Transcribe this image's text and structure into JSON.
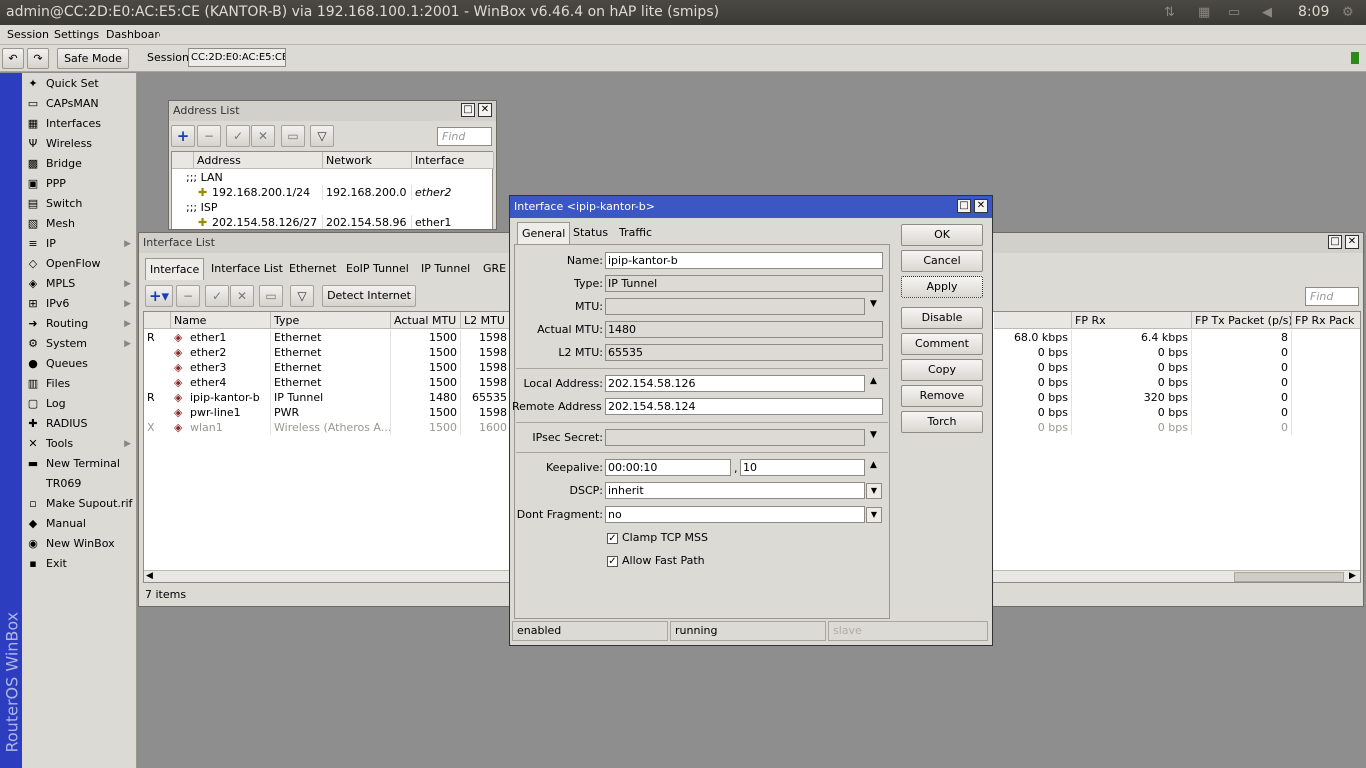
{
  "titlebar": {
    "title": "admin@CC:2D:E0:AC:E5:CE (KANTOR-B) via 192.168.100.1:2001 - WinBox v6.46.4 on hAP lite (smips)",
    "clock": "8:09"
  },
  "menubar": {
    "items": [
      "Session",
      "Settings",
      "Dashboard"
    ]
  },
  "toolbar": {
    "undo": "↶",
    "redo": "↷",
    "safe_mode": "Safe Mode",
    "session_label": "Session:",
    "session_value": "CC:2D:E0:AC:E5:CE"
  },
  "brand": "RouterOS WinBox",
  "sidebar": {
    "items": [
      {
        "label": "Quick Set",
        "icon": "✦",
        "sub": false
      },
      {
        "label": "CAPsMAN",
        "icon": "▭",
        "sub": false
      },
      {
        "label": "Interfaces",
        "icon": "▦",
        "sub": false
      },
      {
        "label": "Wireless",
        "icon": "Ψ",
        "sub": false
      },
      {
        "label": "Bridge",
        "icon": "▩",
        "sub": false
      },
      {
        "label": "PPP",
        "icon": "▣",
        "sub": false
      },
      {
        "label": "Switch",
        "icon": "▤",
        "sub": false
      },
      {
        "label": "Mesh",
        "icon": "▧",
        "sub": false
      },
      {
        "label": "IP",
        "icon": "≡",
        "sub": true
      },
      {
        "label": "OpenFlow",
        "icon": "◇",
        "sub": false
      },
      {
        "label": "MPLS",
        "icon": "◈",
        "sub": true
      },
      {
        "label": "IPv6",
        "icon": "⊞",
        "sub": true
      },
      {
        "label": "Routing",
        "icon": "➜",
        "sub": true
      },
      {
        "label": "System",
        "icon": "⚙",
        "sub": true
      },
      {
        "label": "Queues",
        "icon": "●",
        "sub": false
      },
      {
        "label": "Files",
        "icon": "▥",
        "sub": false
      },
      {
        "label": "Log",
        "icon": "▢",
        "sub": false
      },
      {
        "label": "RADIUS",
        "icon": "✚",
        "sub": false
      },
      {
        "label": "Tools",
        "icon": "✕",
        "sub": true
      },
      {
        "label": "New Terminal",
        "icon": "▬",
        "sub": false
      },
      {
        "label": "TR069",
        "icon": "",
        "sub": false
      },
      {
        "label": "Make Supout.rif",
        "icon": "▫",
        "sub": false
      },
      {
        "label": "Manual",
        "icon": "◆",
        "sub": false
      },
      {
        "label": "New WinBox",
        "icon": "◉",
        "sub": false
      },
      {
        "label": "Exit",
        "icon": "▪",
        "sub": false
      }
    ]
  },
  "address_list": {
    "title": "Address List",
    "find": "Find",
    "columns": [
      "Address",
      "Network",
      "Interface"
    ],
    "rows": [
      {
        "comment": ";;; LAN"
      },
      {
        "address": "192.168.200.1/24",
        "network": "192.168.200.0",
        "interface": "ether2",
        "italic": true
      },
      {
        "comment": ";;; ISP"
      },
      {
        "address": "202.154.58.126/27",
        "network": "202.154.58.96",
        "interface": "ether1",
        "italic": false
      }
    ]
  },
  "interface_list": {
    "title": "Interface List",
    "find": "Find",
    "detect_internet": "Detect Internet",
    "tabs": [
      "Interface",
      "Interface List",
      "Ethernet",
      "EoIP Tunnel",
      "IP Tunnel",
      "GRE T"
    ],
    "columns": [
      "Name",
      "Type",
      "Actual MTU",
      "L2 MTU"
    ],
    "right_columns": [
      "FP Rx",
      "FP Tx Packet (p/s)",
      "FP Rx Pack"
    ],
    "rows": [
      {
        "flag": "R",
        "name": "ether1",
        "type": "Ethernet",
        "amtu": "1500",
        "l2mtu": "1598",
        "c1": "68.0 kbps",
        "fprx": "6.4 kbps",
        "fptx": "8",
        "disabled": false
      },
      {
        "flag": "",
        "name": "ether2",
        "type": "Ethernet",
        "amtu": "1500",
        "l2mtu": "1598",
        "c1": "0 bps",
        "fprx": "0 bps",
        "fptx": "0",
        "disabled": false
      },
      {
        "flag": "",
        "name": "ether3",
        "type": "Ethernet",
        "amtu": "1500",
        "l2mtu": "1598",
        "c1": "0 bps",
        "fprx": "0 bps",
        "fptx": "0",
        "disabled": false
      },
      {
        "flag": "",
        "name": "ether4",
        "type": "Ethernet",
        "amtu": "1500",
        "l2mtu": "1598",
        "c1": "0 bps",
        "fprx": "0 bps",
        "fptx": "0",
        "disabled": false
      },
      {
        "flag": "R",
        "name": "ipip-kantor-b",
        "type": "IP Tunnel",
        "amtu": "1480",
        "l2mtu": "65535",
        "c1": "0 bps",
        "fprx": "320 bps",
        "fptx": "0",
        "disabled": false
      },
      {
        "flag": "",
        "name": "pwr-line1",
        "type": "PWR",
        "amtu": "1500",
        "l2mtu": "1598",
        "c1": "0 bps",
        "fprx": "0 bps",
        "fptx": "0",
        "disabled": false
      },
      {
        "flag": "X",
        "name": "wlan1",
        "type": "Wireless (Atheros A...",
        "amtu": "1500",
        "l2mtu": "1600",
        "c1": "0 bps",
        "fprx": "0 bps",
        "fptx": "0",
        "disabled": true
      }
    ],
    "status": "7 items"
  },
  "dialog": {
    "title": "Interface <ipip-kantor-b>",
    "tabs": [
      "General",
      "Status",
      "Traffic"
    ],
    "fields": {
      "name_label": "Name:",
      "name": "ipip-kantor-b",
      "type_label": "Type:",
      "type": "IP Tunnel",
      "mtu_label": "MTU:",
      "mtu": "",
      "amtu_label": "Actual MTU:",
      "amtu": "1480",
      "l2mtu_label": "L2 MTU:",
      "l2mtu": "65535",
      "local_label": "Local Address:",
      "local": "202.154.58.126",
      "remote_label": "Remote Address:",
      "remote": "202.154.58.124",
      "ipsec_label": "IPsec Secret:",
      "ipsec": "",
      "keepalive_label": "Keepalive:",
      "keepalive1": "00:00:10",
      "keepalive_sep": ",",
      "keepalive2": "10",
      "dscp_label": "DSCP:",
      "dscp": "inherit",
      "dontfrag_label": "Dont Fragment:",
      "dontfrag": "no",
      "clamp": "Clamp TCP MSS",
      "fastpath": "Allow Fast Path"
    },
    "buttons": [
      "OK",
      "Cancel",
      "Apply",
      "Disable",
      "Comment",
      "Copy",
      "Remove",
      "Torch"
    ],
    "status": [
      "enabled",
      "running",
      "slave"
    ]
  }
}
